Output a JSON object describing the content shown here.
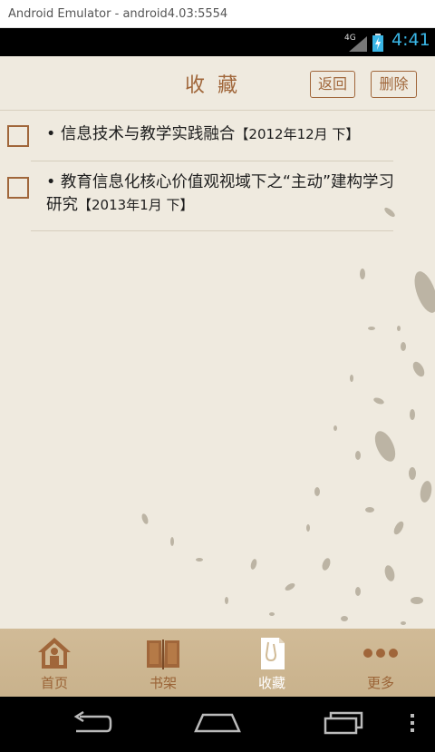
{
  "window": {
    "title": "Android Emulator - android4.03:5554"
  },
  "status_bar": {
    "network": "4G",
    "time": "4:41"
  },
  "header": {
    "title": "收藏",
    "back_label": "返回",
    "delete_label": "删除"
  },
  "favorites": [
    {
      "title": "信息技术与教学实践融合",
      "issue": "【2012年12月 下】"
    },
    {
      "title": "教育信息化核心价值观视域下之“主动”建构学习",
      "title_cont": "研究",
      "issue": "【2013年1月 下】"
    }
  ],
  "bullet": "•",
  "tabs": [
    {
      "label": "首页",
      "icon": "home-icon",
      "active": false
    },
    {
      "label": "书架",
      "icon": "book-icon",
      "active": false
    },
    {
      "label": "收藏",
      "icon": "favorites-icon",
      "active": true
    },
    {
      "label": "更多",
      "icon": "more-icon",
      "active": false
    }
  ],
  "colors": {
    "accent": "#a0663a",
    "background": "#efeadf",
    "tabbar": "#cdb691",
    "time": "#3ab6e6"
  }
}
